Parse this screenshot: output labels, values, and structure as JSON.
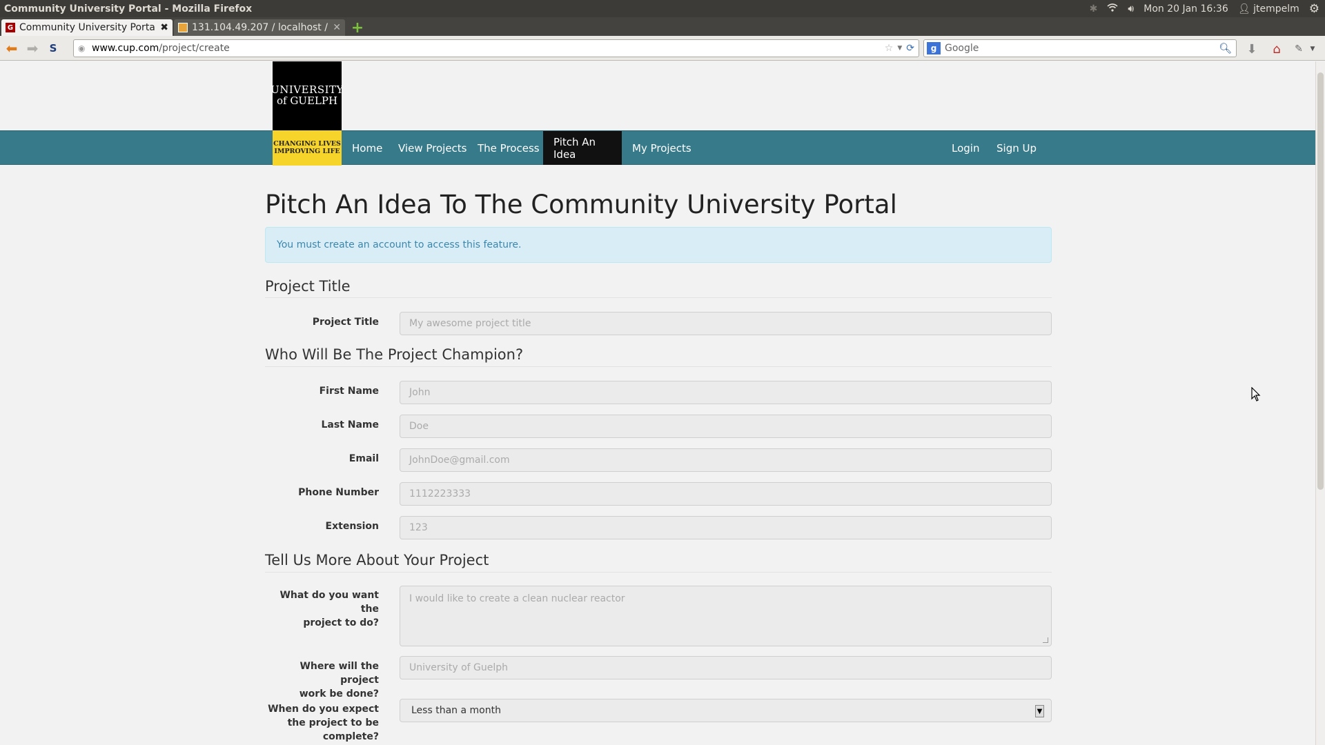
{
  "window": {
    "title": "Community University Portal - Mozilla Firefox",
    "clock": "Mon 20 Jan 16:36",
    "user": "jtempelm"
  },
  "tabs": [
    {
      "label": "Community University Portal",
      "active": true
    },
    {
      "label": "131.104.49.207 / localhost /...",
      "active": false
    }
  ],
  "browser": {
    "url_domain": "www.cup.com",
    "url_path": "/project/create",
    "search_placeholder": "Google"
  },
  "site": {
    "logo_line1": "UNIVERSITY",
    "logo_line2": "of GUELPH",
    "tagline_line1": "CHANGING LIVES",
    "tagline_line2": "IMPROVING LIFE",
    "nav": [
      "Home",
      "View Projects",
      "The Process",
      "Pitch An Idea",
      "My Projects"
    ],
    "nav_active": "Pitch An Idea",
    "nav_right": [
      "Login",
      "Sign Up"
    ]
  },
  "page": {
    "title": "Pitch An Idea To The Community University Portal",
    "alert": "You must create an account to access this feature.",
    "sections": {
      "project_title": "Project Title",
      "champion": "Who Will Be The Project Champion?",
      "more": "Tell Us More About Your Project"
    },
    "fields": {
      "project_title": {
        "label": "Project Title",
        "placeholder": "My awesome project title"
      },
      "first_name": {
        "label": "First Name",
        "placeholder": "John"
      },
      "last_name": {
        "label": "Last Name",
        "placeholder": "Doe"
      },
      "email": {
        "label": "Email",
        "placeholder": "JohnDoe@gmail.com"
      },
      "phone": {
        "label": "Phone Number",
        "placeholder": "1112223333"
      },
      "extension": {
        "label": "Extension",
        "placeholder": "123"
      },
      "what": {
        "label_line1": "What do you want the",
        "label_line2": "project to do?",
        "placeholder": "I would like to create a clean nuclear reactor"
      },
      "where": {
        "label_line1": "Where will the project",
        "label_line2": "work be done?",
        "placeholder": "University of Guelph"
      },
      "when": {
        "label_line1": "When do you expect",
        "label_line2": "the project to be",
        "label_line3": "complete?",
        "value": "Less than a month"
      }
    }
  }
}
